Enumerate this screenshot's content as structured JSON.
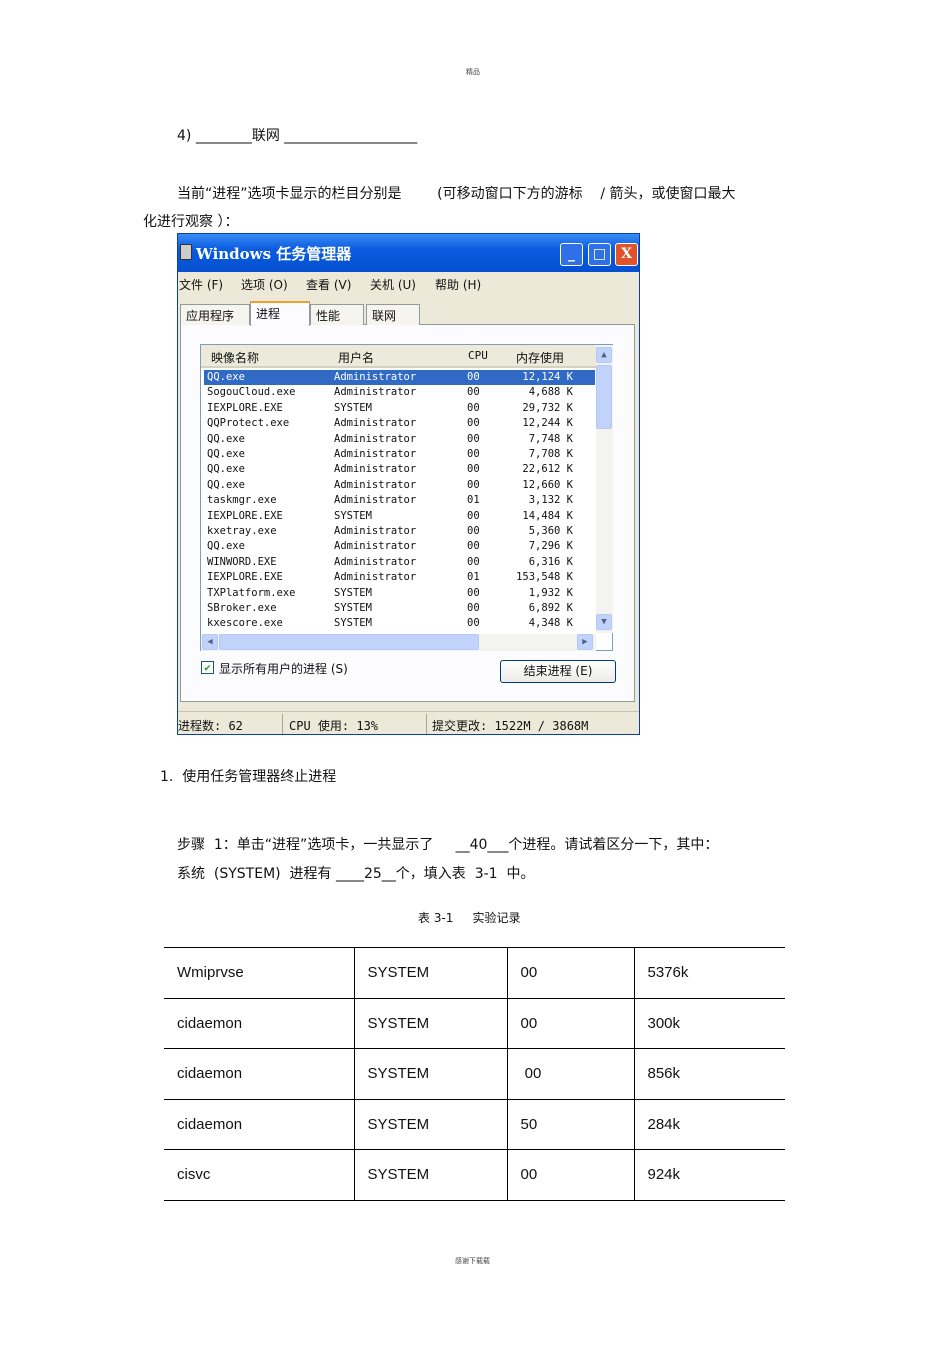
{
  "header": "精品",
  "footer": "感谢下载载",
  "item4": "4) ________联网 ___________________",
  "intro_line1": "当前“进程”选项卡显示的栏目分别是        (可移动窗口下方的游标    / 箭头，或使窗口最大",
  "intro_line2": "化进行观察 ）：",
  "taskmgr": {
    "title": "Windows 任务管理器",
    "buttons": {
      "minimize": "_",
      "maximize": "□",
      "close": "X"
    },
    "menu": [
      "文件 (F)",
      "选项 (O)",
      "查看 (V)",
      "关机 (U)",
      "帮助 (H)"
    ],
    "tabs": [
      "应用程序",
      "进程",
      "性能",
      "联网"
    ],
    "columns": [
      "映像名称",
      "用户名",
      "CPU",
      "内存使用"
    ],
    "rows": [
      [
        "QQ.exe",
        "Administrator",
        "00",
        "12,124 K"
      ],
      [
        "SogouCloud.exe",
        "Administrator",
        "00",
        "4,688 K"
      ],
      [
        "IEXPLORE.EXE",
        "SYSTEM",
        "00",
        "29,732 K"
      ],
      [
        "QQProtect.exe",
        "Administrator",
        "00",
        "12,244 K"
      ],
      [
        "QQ.exe",
        "Administrator",
        "00",
        "7,748 K"
      ],
      [
        "QQ.exe",
        "Administrator",
        "00",
        "7,708 K"
      ],
      [
        "QQ.exe",
        "Administrator",
        "00",
        "22,612 K"
      ],
      [
        "QQ.exe",
        "Administrator",
        "00",
        "12,660 K"
      ],
      [
        "taskmgr.exe",
        "Administrator",
        "01",
        "3,132 K"
      ],
      [
        "IEXPLORE.EXE",
        "SYSTEM",
        "00",
        "14,484 K"
      ],
      [
        "kxetray.exe",
        "Administrator",
        "00",
        "5,360 K"
      ],
      [
        "QQ.exe",
        "Administrator",
        "00",
        "7,296 K"
      ],
      [
        "WINWORD.EXE",
        "Administrator",
        "00",
        "6,316 K"
      ],
      [
        "IEXPLORE.EXE",
        "Administrator",
        "01",
        "153,548 K"
      ],
      [
        "TXPlatform.exe",
        "SYSTEM",
        "00",
        "1,932 K"
      ],
      [
        "SBroker.exe",
        "SYSTEM",
        "00",
        "6,892 K"
      ],
      [
        "kxescore.exe",
        "SYSTEM",
        "00",
        "4,348 K"
      ]
    ],
    "selected_row": 0,
    "show_all_label": "显示所有用户的进程 (S)",
    "show_all_checked": true,
    "end_process": "结束进程 (E)",
    "status": {
      "processes": "进程数: 62",
      "cpu": "CPU 使用: 13%",
      "commit": "提交更改: 1522M / 3868M"
    }
  },
  "section_title": "1.  使用任务管理器终止进程",
  "step1_line1": "步骤  1：单击“进程”选项卡，一共显示了     __40___个进程。请试着区分一下，其中：",
  "step1_line2": "系统  (SYSTEM)  进程有 ____25__个，填入表  3-1  中。",
  "table_caption": "表 3-1     实验记录",
  "table_rows": [
    [
      "Wmiprvse",
      "SYSTEM",
      "00",
      "5376k"
    ],
    [
      "cidaemon",
      "SYSTEM",
      "00",
      "300k"
    ],
    [
      "cidaemon",
      "SYSTEM",
      " 00",
      "856k"
    ],
    [
      "cidaemon",
      "SYSTEM",
      "50",
      "284k"
    ],
    [
      "cisvc",
      "SYSTEM",
      "00",
      "924k"
    ]
  ]
}
